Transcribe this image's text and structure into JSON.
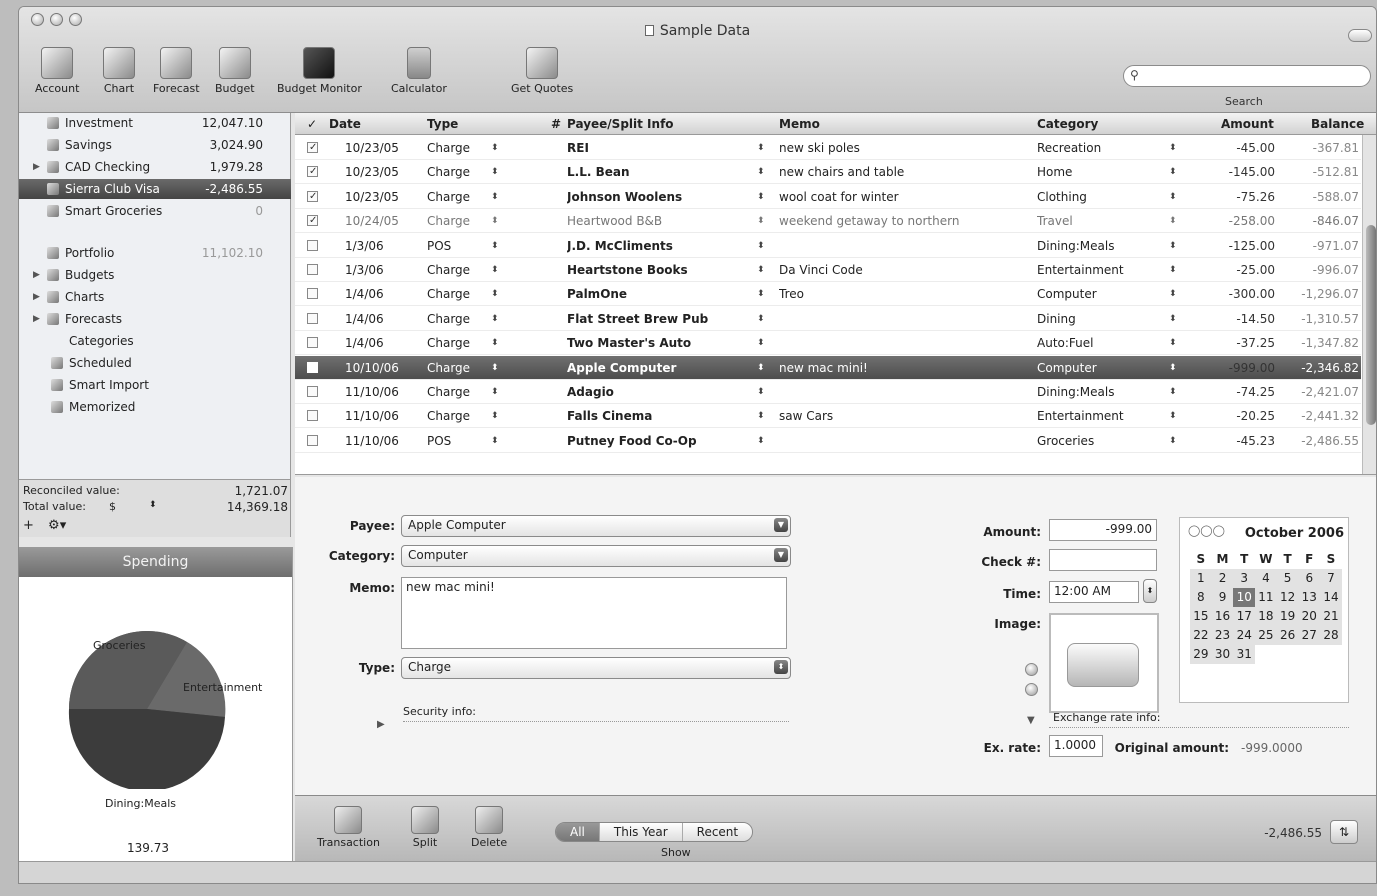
{
  "window": {
    "title": "Sample Data"
  },
  "toolbar": {
    "items": [
      {
        "label": "Account",
        "icon": "account-icon"
      },
      {
        "label": "Chart",
        "icon": "chart-icon"
      },
      {
        "label": "Forecast",
        "icon": "forecast-icon"
      },
      {
        "label": "Budget",
        "icon": "budget-icon"
      },
      {
        "label": "Budget Monitor",
        "icon": "budget-monitor-icon"
      },
      {
        "label": "Calculator",
        "icon": "calculator-icon"
      },
      {
        "label": "Get Quotes",
        "icon": "get-quotes-icon"
      }
    ],
    "search_label": "Search"
  },
  "sidebar": {
    "items": [
      {
        "label": "Investment",
        "value": "12,047.10",
        "icon": "investment-icon"
      },
      {
        "label": "Savings",
        "value": "3,024.90",
        "icon": "savings-icon"
      },
      {
        "label": "CAD Checking",
        "value": "1,979.28",
        "icon": "checking-icon"
      },
      {
        "label": "Sierra Club Visa",
        "value": "-2,486.55",
        "icon": "credit-card-icon"
      },
      {
        "label": "Smart Groceries",
        "value": "0",
        "icon": "smart-account-icon"
      },
      {
        "label": "Portfolio",
        "value": "11,102.10",
        "icon": "portfolio-icon"
      },
      {
        "label": "Budgets",
        "value": "",
        "icon": "budgets-icon"
      },
      {
        "label": "Charts",
        "value": "",
        "icon": "charts-icon"
      },
      {
        "label": "Forecasts",
        "value": "",
        "icon": "forecasts-icon"
      },
      {
        "label": "Categories",
        "value": "",
        "icon": "categories-icon"
      },
      {
        "label": "Scheduled",
        "value": "",
        "icon": "scheduled-icon"
      },
      {
        "label": "Smart Import",
        "value": "",
        "icon": "smart-import-icon"
      },
      {
        "label": "Memorized",
        "value": "",
        "icon": "memorized-icon"
      }
    ],
    "footer": {
      "reconciled_label": "Reconciled value:",
      "reconciled_value": "1,721.07",
      "total_label": "Total value:",
      "currency": "$",
      "total_value": "14,369.18"
    }
  },
  "spending": {
    "title": "Spending",
    "total": "139.73",
    "labels": [
      "Groceries",
      "Entertainment",
      "Dining:Meals"
    ]
  },
  "register": {
    "columns": [
      "Date",
      "Type",
      "#",
      "Payee/Split Info",
      "Memo",
      "Category",
      "Amount",
      "Balance"
    ],
    "rows": [
      {
        "checked": true,
        "date": "10/23/05",
        "type": "Charge",
        "payee": "REI",
        "memo": "new ski poles",
        "category": "Recreation",
        "amount": "-45.00",
        "balance": "-367.81"
      },
      {
        "checked": true,
        "date": "10/23/05",
        "type": "Charge",
        "payee": "L.L. Bean",
        "memo": "new chairs and table",
        "category": "Home",
        "amount": "-145.00",
        "balance": "-512.81"
      },
      {
        "checked": true,
        "date": "10/23/05",
        "type": "Charge",
        "payee": "Johnson Woolens",
        "memo": "wool coat for winter",
        "category": "Clothing",
        "amount": "-75.26",
        "balance": "-588.07"
      },
      {
        "checked": true,
        "date": "10/24/05",
        "type": "Charge",
        "payee": "Heartwood B&B",
        "memo": "weekend getaway to northern",
        "category": "Travel",
        "amount": "-258.00",
        "balance": "-846.07"
      },
      {
        "checked": false,
        "date": "1/3/06",
        "type": "POS",
        "payee": "J.D. McCliments",
        "memo": "",
        "category": "Dining:Meals",
        "amount": "-125.00",
        "balance": "-971.07"
      },
      {
        "checked": false,
        "date": "1/3/06",
        "type": "Charge",
        "payee": "Heartstone Books",
        "memo": "Da Vinci Code",
        "category": "Entertainment",
        "amount": "-25.00",
        "balance": "-996.07"
      },
      {
        "checked": false,
        "date": "1/4/06",
        "type": "Charge",
        "payee": "PalmOne",
        "memo": "Treo",
        "category": "Computer",
        "amount": "-300.00",
        "balance": "-1,296.07"
      },
      {
        "checked": false,
        "date": "1/4/06",
        "type": "Charge",
        "payee": "Flat Street Brew Pub",
        "memo": "",
        "category": "Dining",
        "amount": "-14.50",
        "balance": "-1,310.57"
      },
      {
        "checked": false,
        "date": "1/4/06",
        "type": "Charge",
        "payee": "Two Master's Auto",
        "memo": "",
        "category": "Auto:Fuel",
        "amount": "-37.25",
        "balance": "-1,347.82"
      },
      {
        "checked": false,
        "date": "10/10/06",
        "type": "Charge",
        "payee": "Apple Computer",
        "memo": "new mac mini!",
        "category": "Computer",
        "amount": "-999.00",
        "balance": "-2,346.82"
      },
      {
        "checked": false,
        "date": "11/10/06",
        "type": "Charge",
        "payee": "Adagio",
        "memo": "",
        "category": "Dining:Meals",
        "amount": "-74.25",
        "balance": "-2,421.07"
      },
      {
        "checked": false,
        "date": "11/10/06",
        "type": "Charge",
        "payee": "Falls Cinema",
        "memo": "saw Cars",
        "category": "Entertainment",
        "amount": "-20.25",
        "balance": "-2,441.32"
      },
      {
        "checked": false,
        "date": "11/10/06",
        "type": "POS",
        "payee": "Putney Food Co-Op",
        "memo": "",
        "category": "Groceries",
        "amount": "-45.23",
        "balance": "-2,486.55"
      }
    ]
  },
  "detail": {
    "payee_label": "Payee:",
    "payee": "Apple Computer",
    "category_label": "Category:",
    "category": "Computer",
    "memo_label": "Memo:",
    "memo": "new mac mini!",
    "type_label": "Type:",
    "type": "Charge",
    "security_label": "Security info:",
    "amount_label": "Amount:",
    "amount": "-999.00",
    "check_label": "Check #:",
    "check": "",
    "time_label": "Time:",
    "time": "12:00 AM",
    "image_label": "Image:",
    "exchange_label": "Exchange rate info:",
    "exrate_label": "Ex. rate:",
    "exrate": "1.0000",
    "original_label": "Original amount:",
    "original": "-999.0000"
  },
  "calendar": {
    "title": "October 2006",
    "weekdays": [
      "S",
      "M",
      "T",
      "W",
      "T",
      "F",
      "S"
    ],
    "weeks": [
      [
        "1",
        "2",
        "3",
        "4",
        "5",
        "6",
        "7"
      ],
      [
        "8",
        "9",
        "10",
        "11",
        "12",
        "13",
        "14"
      ],
      [
        "15",
        "16",
        "17",
        "18",
        "19",
        "20",
        "21"
      ],
      [
        "22",
        "23",
        "24",
        "25",
        "26",
        "27",
        "28"
      ],
      [
        "29",
        "30",
        "31",
        "",
        "",
        "",
        ""
      ]
    ],
    "selected": "10"
  },
  "bottombar": {
    "buttons": [
      {
        "label": "Transaction",
        "icon": "transaction-icon"
      },
      {
        "label": "Split",
        "icon": "split-icon"
      },
      {
        "label": "Delete",
        "icon": "delete-icon"
      }
    ],
    "filters": [
      "All",
      "This Year",
      "Recent"
    ],
    "selected_filter": "All",
    "show_label": "Show",
    "ending_balance": "-2,486.55"
  },
  "colors": {
    "selection": "#5a5a5a",
    "pie_fill": "#4a4a4a"
  }
}
